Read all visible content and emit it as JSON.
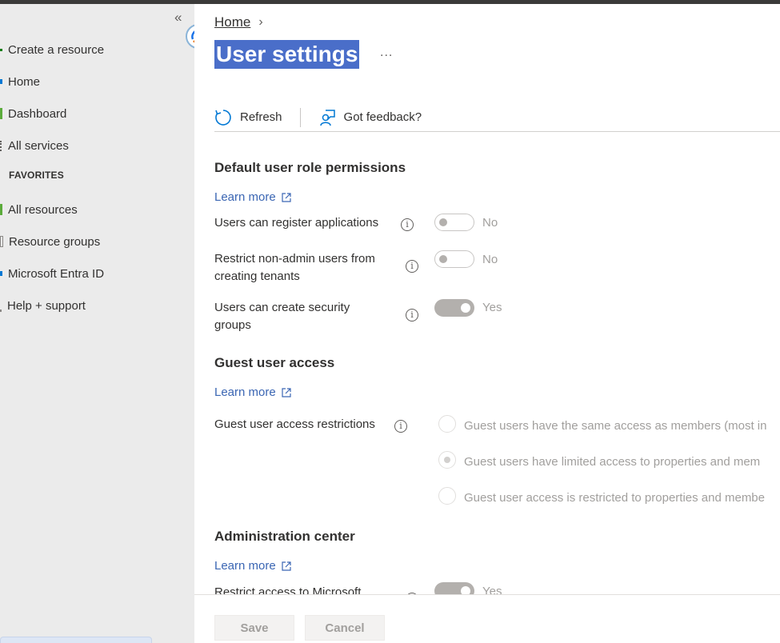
{
  "sidebar": {
    "collapse_glyph": "«",
    "items": [
      {
        "label": "Create a resource",
        "icon": "plus-icon",
        "color": "#107c10"
      },
      {
        "label": "Home",
        "icon": "home-icon",
        "color": "#0078d4"
      },
      {
        "label": "Dashboard",
        "icon": "dashboard-icon",
        "color": "#5bab3b"
      },
      {
        "label": "All services",
        "icon": "list-icon",
        "color": "#605e5c"
      }
    ],
    "favorites_header": "FAVORITES",
    "favorites": [
      {
        "label": "All resources",
        "icon": "all-resources-icon",
        "color": "#5bab3b"
      },
      {
        "label": "Resource groups",
        "icon": "resource-groups-icon",
        "color": "#8a8886"
      },
      {
        "label": "Microsoft Entra ID",
        "icon": "entra-id-icon",
        "color": "#0078d4"
      },
      {
        "label": "Help + support",
        "icon": "help-icon",
        "color": "#605e5c"
      }
    ]
  },
  "breadcrumb": {
    "home": "Home",
    "separator": "›"
  },
  "page": {
    "title": "User settings",
    "more": "..."
  },
  "toolbar": {
    "refresh": "Refresh",
    "feedback": "Got feedback?"
  },
  "sections": {
    "default_permissions": {
      "title": "Default user role permissions",
      "learn_more": "Learn more",
      "settings": [
        {
          "label": "Users can register applications",
          "value": "No",
          "on": false
        },
        {
          "label": "Restrict non-admin users from creating tenants",
          "value": "No",
          "on": false
        },
        {
          "label": "Users can create security groups",
          "value": "Yes",
          "on": true
        }
      ]
    },
    "guest_access": {
      "title": "Guest user access",
      "learn_more": "Learn more",
      "restriction_label": "Guest user access restrictions",
      "options": [
        {
          "label": "Guest users have the same access as members (most in",
          "checked": false
        },
        {
          "label": "Guest users have limited access to properties and mem",
          "checked": true
        },
        {
          "label": "Guest user access is restricted to properties and membe",
          "checked": false
        }
      ]
    },
    "admin_center": {
      "title": "Administration center",
      "learn_more": "Learn more",
      "setting_label": "Restrict access to Microsoft",
      "setting_value": "Yes"
    }
  },
  "footer": {
    "save": "Save",
    "cancel": "Cancel"
  },
  "colors": {
    "accent": "#4a6ec9",
    "link": "#3b66b3",
    "sidebar_bg": "#ebebeb"
  }
}
